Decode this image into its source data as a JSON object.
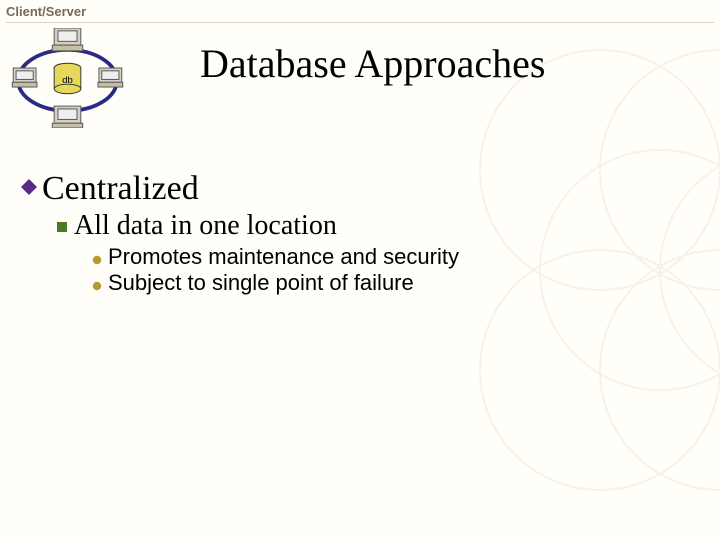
{
  "header": {
    "label": "Client/Server"
  },
  "logo": {
    "db_label": "db"
  },
  "slide": {
    "title": "Database Approaches"
  },
  "bullets": {
    "lvl1_0": "Centralized",
    "lvl2_0": "All data in one location",
    "lvl3_0": "Promotes maintenance and security",
    "lvl3_1": "Subject to single point of failure"
  }
}
